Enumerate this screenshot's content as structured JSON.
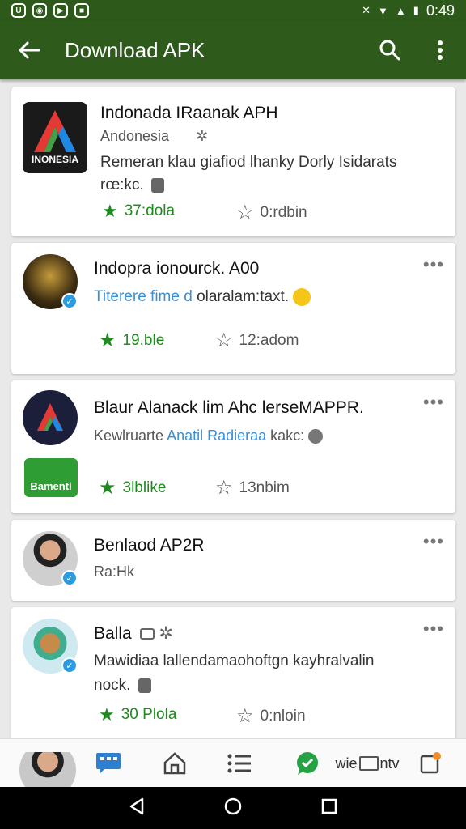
{
  "status": {
    "time": "0:49"
  },
  "appbar": {
    "title": "Download APK"
  },
  "cards": [
    {
      "title": "Indonada IRaanak APH",
      "subtitle": "Andonesia",
      "logo_text": "INONESIA",
      "description1": "Remeran klau giafiod lhanky Dorly Isidarats",
      "description2": "rœ:kc.",
      "rating": "37:dola",
      "fav": "0:rdbin"
    },
    {
      "title": "Indopra ionourck. A00",
      "link": "Titerere fime d",
      "description": "olaralam:taxt.",
      "rating": "19.ble",
      "fav": "12:adom"
    },
    {
      "title": "Blaur Alanack lim Ahc lerseMAPPR.",
      "sub_prefix": "Kewlruarte",
      "link": "Anatil Radieraa",
      "sub_suffix": "kakc",
      "badge_text": "Bamentl",
      "rating": "3lblike",
      "fav": "13nbim"
    },
    {
      "title": "Benlaod AP2R",
      "subtitle": "Ra:Hk"
    },
    {
      "title": "Balla",
      "description1": "Mawidiaa lallendamaohoftgn kayhralvalin",
      "description2": "nock.",
      "rating": "30 Plola",
      "fav": "0:nloin"
    }
  ],
  "tabbar": {
    "tab_text": "wie",
    "tab_text2": "ntv"
  },
  "colors": {
    "appbar": "#2e5a1c",
    "accent_green": "#1e8a1e",
    "link_blue": "#3a8fd6"
  }
}
